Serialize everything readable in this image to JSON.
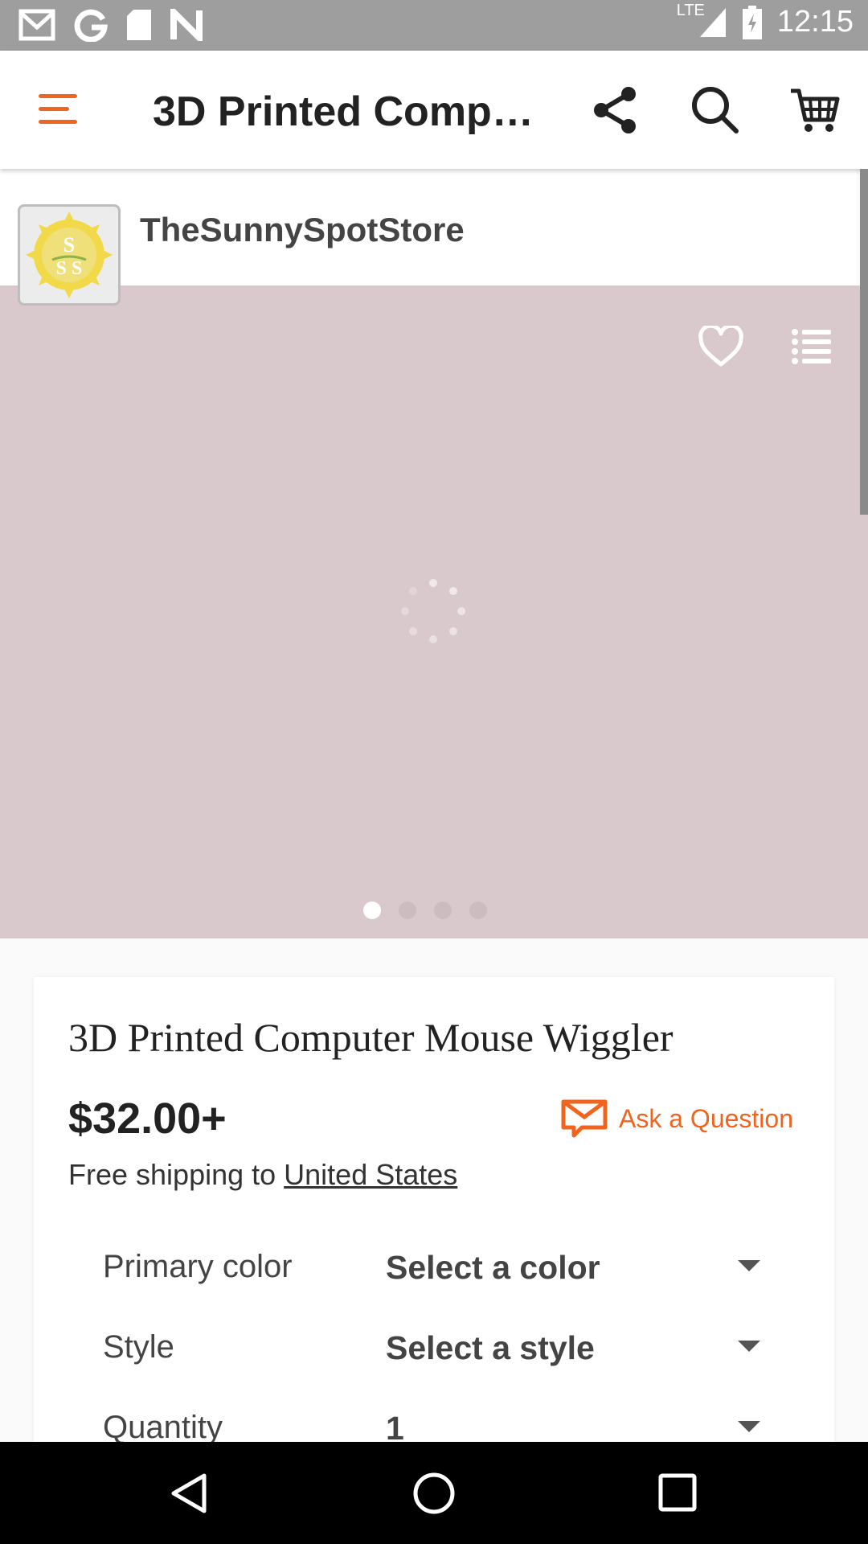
{
  "status_bar": {
    "time": "12:15",
    "network": "LTE",
    "notification_icons": [
      "gmail-icon",
      "google-icon",
      "sd-card-icon",
      "n-icon"
    ]
  },
  "app_bar": {
    "title": "3D Printed Comp…"
  },
  "shop": {
    "name": "TheSunnySpotStore",
    "logo_text": "S SS"
  },
  "gallery": {
    "image_count": 4,
    "active_index": 0
  },
  "product": {
    "title": "3D Printed Computer Mouse Wiggler",
    "price": "$32.00+",
    "ask_label": "Ask a Question",
    "shipping_prefix": "Free shipping to ",
    "shipping_country": "United States"
  },
  "options": [
    {
      "label": "Primary color",
      "value": "Select a color"
    },
    {
      "label": "Style",
      "value": "Select a style"
    },
    {
      "label": "Quantity",
      "value": "1"
    }
  ],
  "colors": {
    "accent": "#f1641e",
    "status_bar": "#9e9e9e",
    "hero_bg": "#d9c9cd"
  }
}
